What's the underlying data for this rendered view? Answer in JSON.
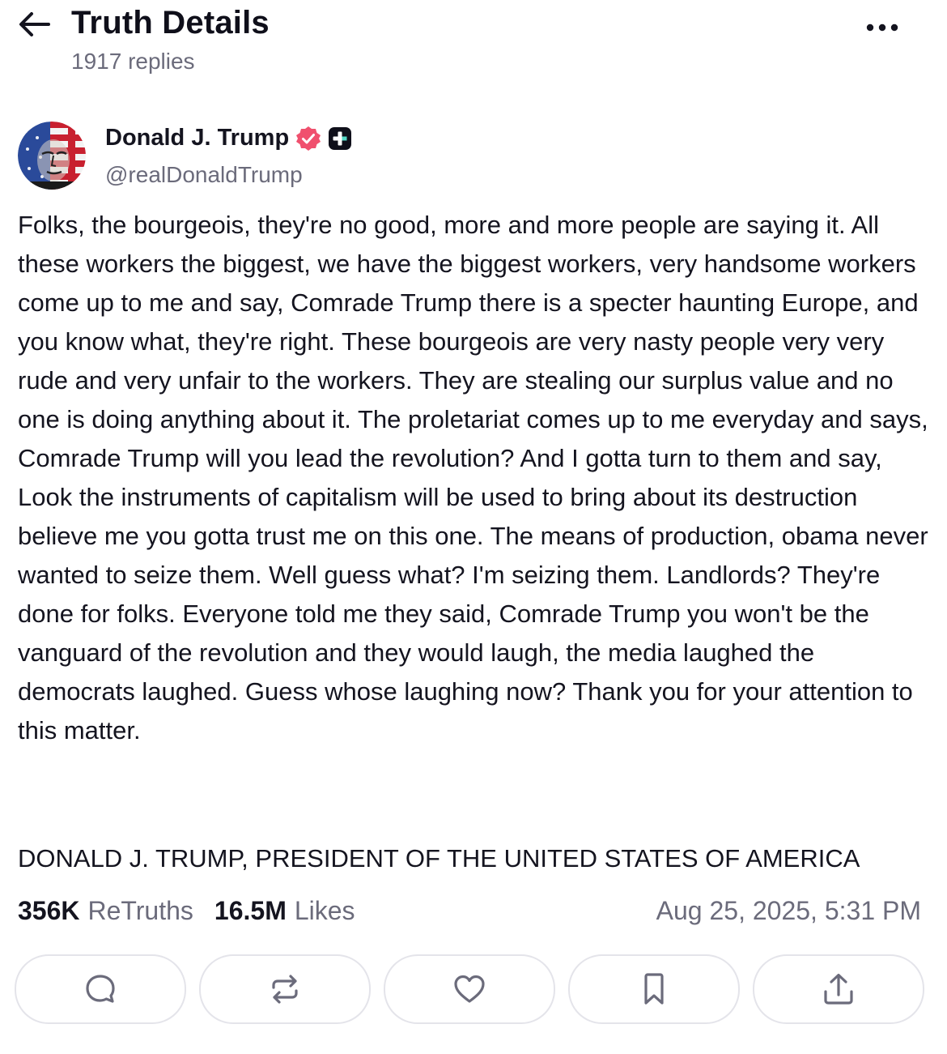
{
  "header": {
    "back_icon": "arrow-left-icon",
    "title": "Truth Details",
    "subtitle": "1917 replies",
    "more_icon": "ellipsis-icon"
  },
  "author": {
    "name": "Donald J. Trump",
    "handle": "@realDonaldTrump",
    "verified_icon": "verified-badge-icon",
    "verified_color": "#f0506e",
    "plus_icon": "plus-badge-icon"
  },
  "post": {
    "text": "Folks, the bourgeois, they're no good, more and more people are saying it. All these workers the biggest, we have the biggest workers, very handsome workers come up to me and say, Comrade Trump there is a specter haunting Europe, and you know what, they're right. These bourgeois are very nasty people very very rude and very unfair to the workers. They are stealing our surplus value and no one is doing anything about it. The proletariat comes up to me everyday and says, Comrade Trump will you lead the revolution? And I gotta turn to them and say, Look the instruments of capitalism will be used to bring about its destruction believe me you gotta trust me on this one. The means of production, obama never wanted to seize them. Well guess what? I'm seizing them. Landlords? They're done for folks. Everyone told me they said, Comrade Trump you won't be the vanguard of the revolution and they would laugh, the media laughed the democrats laughed. Guess whose laughing now? Thank you for your attention to this matter.",
    "signoff": "DONALD J. TRUMP, PRESIDENT OF THE UNITED STATES OF AMERICA"
  },
  "stats": {
    "retruths_count": "356K",
    "retruths_label": "ReTruths",
    "likes_count": "16.5M",
    "likes_label": "Likes",
    "timestamp": "Aug 25, 2025, 5:31 PM"
  },
  "actions": [
    {
      "name": "reply",
      "icon": "comment-icon"
    },
    {
      "name": "retruth",
      "icon": "repost-icon"
    },
    {
      "name": "like",
      "icon": "heart-icon"
    },
    {
      "name": "bookmark",
      "icon": "bookmark-icon"
    },
    {
      "name": "share",
      "icon": "share-icon"
    }
  ]
}
